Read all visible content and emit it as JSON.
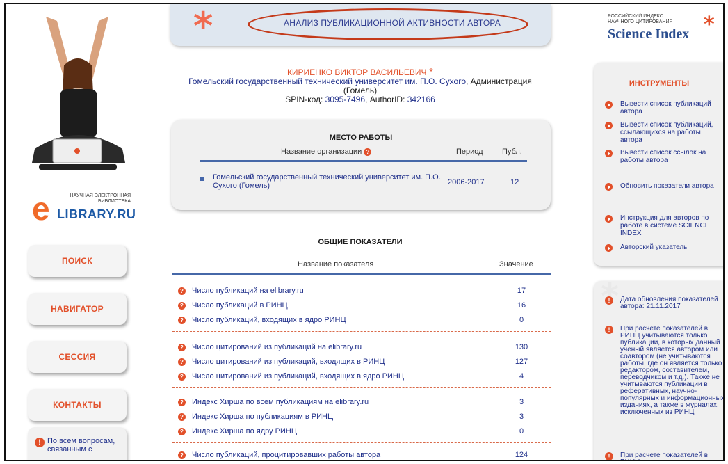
{
  "header": {
    "title": "АНАЛИЗ ПУБЛИКАЦИОННОЙ АКТИВНОСТИ АВТОРА"
  },
  "elibrary": {
    "top_line1": "НАУЧНАЯ ЭЛЕКТРОННАЯ",
    "top_line2": "БИБЛИОТЕКА",
    "word": "LIBRARY.RU"
  },
  "nav": [
    {
      "label": "ПОИСК"
    },
    {
      "label": "НАВИГАТОР"
    },
    {
      "label": "СЕССИЯ"
    },
    {
      "label": "КОНТАКТЫ"
    }
  ],
  "help_box": {
    "text": "По всем вопросам, связанным с"
  },
  "author": {
    "name": "КИРИЕНКО ВИКТОР ВАСИЛЬЕВИЧ",
    "affil": "Гомельский государственный технический университет им. П.О. Сухого",
    "affil_tail": ", Администрация",
    "city": "(Гомель)",
    "spin_label": "SPIN-код: ",
    "spin": "3095-7496",
    "authorid_label": ", AuthorID: ",
    "authorid": "342166"
  },
  "work": {
    "title": "МЕСТО РАБОТЫ",
    "col_org": "Название организации",
    "col_period": "Период",
    "col_pubs": "Публ.",
    "org": "Гомельский государственный технический университет им. П.О. Сухого",
    "org_city": " (Гомель)",
    "period": "2006-2017",
    "pubs": "12"
  },
  "indicators": {
    "title": "ОБЩИЕ ПОКАЗАТЕЛИ",
    "col_name": "Название показателя",
    "col_value": "Значение",
    "rows": [
      {
        "label": "Число публикаций на elibrary.ru",
        "value": "17"
      },
      {
        "label": "Число публикаций в РИНЦ",
        "value": "16"
      },
      {
        "label": "Число публикаций, входящих в ядро РИНЦ",
        "value": "0"
      },
      {
        "label": "Число цитирований из публикаций на elibrary.ru",
        "value": "130"
      },
      {
        "label": "Число цитирований из публикаций, входящих в РИНЦ",
        "value": "127"
      },
      {
        "label": "Число цитирований из публикаций, входящих в ядро РИНЦ",
        "value": "4"
      },
      {
        "label": "Индекс Хирша по всем публикациям на elibrary.ru",
        "value": "3"
      },
      {
        "label": "Индекс Хирша по публикациям в РИНЦ",
        "value": "3"
      },
      {
        "label": "Индекс Хирша по ядру РИНЦ",
        "value": "0"
      },
      {
        "label": "Число публикаций, процитировавших работы автора",
        "value": "124"
      }
    ]
  },
  "science_index": {
    "line1": "РОССИЙСКИЙ ИНДЕКС",
    "line2": "НАУЧНОГО ЦИТИРОВАНИЯ",
    "big": "Science Index"
  },
  "tools": {
    "title": "ИНСТРУМЕНТЫ",
    "items": [
      "Вывести список публикаций автора",
      "Вывести список публикаций, ссылающихся на работы автора",
      "Вывести список ссылок на работы автора",
      "Обновить показатели автора",
      "Инструкция для авторов по работе в системе SCIENCE INDEX",
      "Авторский указатель"
    ]
  },
  "info": {
    "items": [
      "Дата обновления показателей автора: 21.11.2017",
      "При расчете показателей в РИНЦ учитываются только публикации, в которых данный ученый является автором или соавтором (не учитываются работы, где он является только редактором, составителем, переводчиком и т.д.). Также не учитываются публикации в реферативных, научно-популярных и информационных изданиях, а также в журналах, исключенных из РИНЦ",
      "При расчете показателей в РИНЦ не учитываются"
    ]
  },
  "colors": {
    "accent": "#e2502a",
    "link": "#1f2f8a",
    "rule": "#4668a8"
  }
}
